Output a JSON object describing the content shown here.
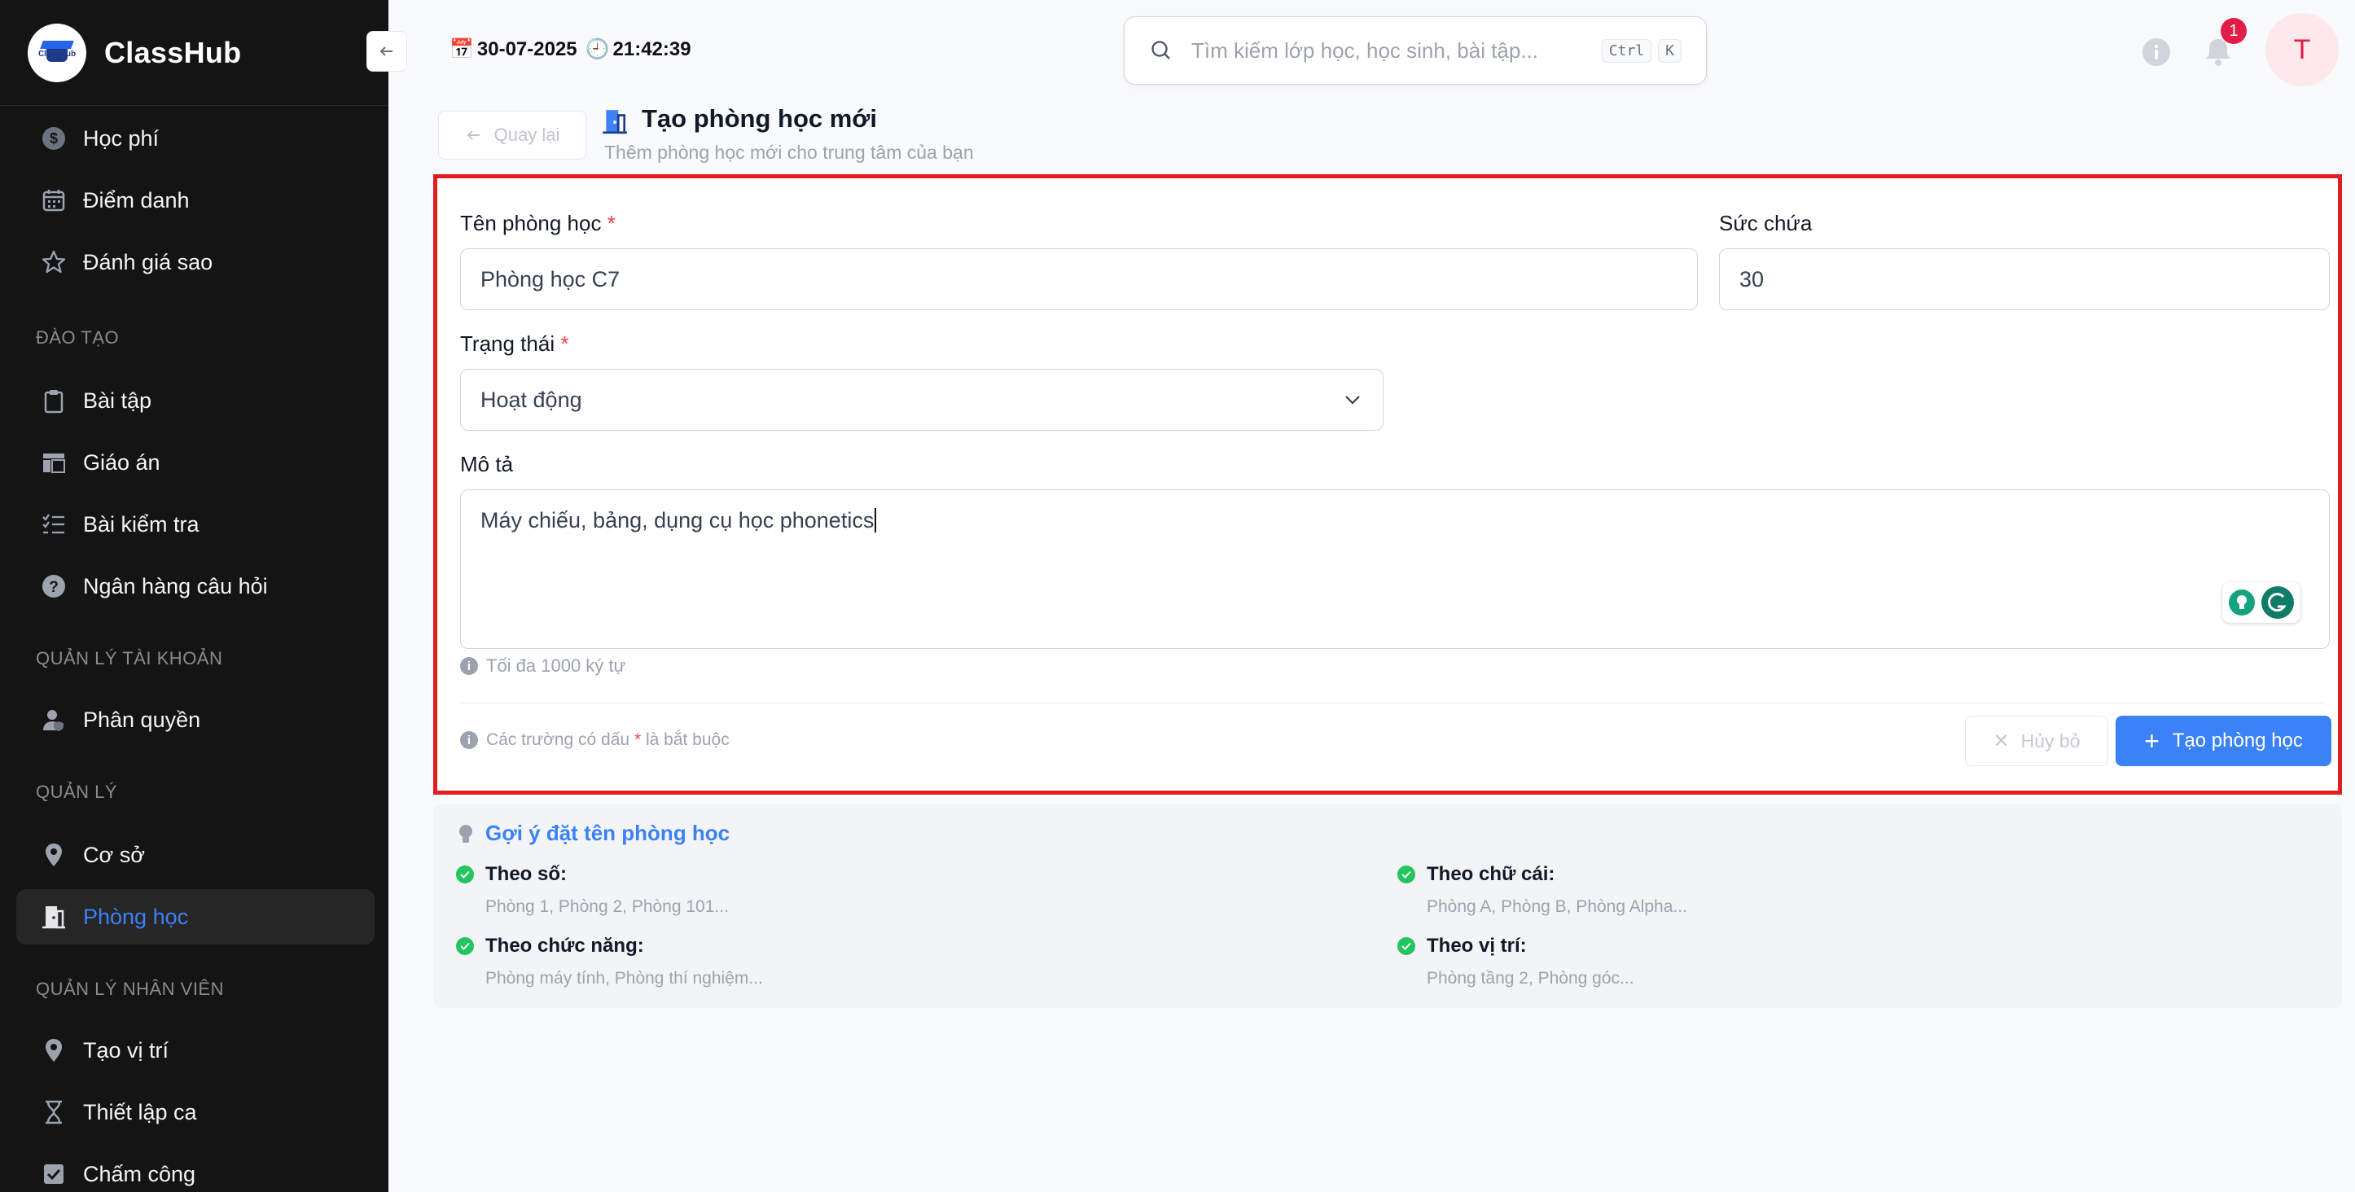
{
  "brand": {
    "name": "ClassHub",
    "logo_text": "ClassHub"
  },
  "sidebar": {
    "items_top": [
      {
        "label": "Học phí",
        "icon": "dollar-icon"
      },
      {
        "label": "Điểm danh",
        "icon": "calendar-icon"
      },
      {
        "label": "Đánh giá sao",
        "icon": "star-icon"
      }
    ],
    "sections": {
      "training": "ĐÀO TẠO",
      "account": "QUẢN LÝ TÀI KHOẢN",
      "manage": "QUẢN LÝ",
      "staff": "QUẢN LÝ NHÂN VIÊN"
    },
    "training_items": [
      {
        "label": "Bài tập",
        "icon": "clipboard-icon"
      },
      {
        "label": "Giáo án",
        "icon": "layout-icon"
      },
      {
        "label": "Bài kiểm tra",
        "icon": "checklist-icon"
      },
      {
        "label": "Ngân hàng câu hỏi",
        "icon": "question-icon"
      }
    ],
    "account_items": [
      {
        "label": "Phân quyền",
        "icon": "user-shield-icon"
      }
    ],
    "manage_items": [
      {
        "label": "Cơ sở",
        "icon": "location-icon"
      },
      {
        "label": "Phòng học",
        "icon": "door-icon",
        "active": true
      }
    ],
    "staff_items": [
      {
        "label": "Tạo vị trí",
        "icon": "location-icon"
      },
      {
        "label": "Thiết lập ca",
        "icon": "hourglass-icon"
      },
      {
        "label": "Chấm công",
        "icon": "check-square-icon"
      }
    ]
  },
  "header": {
    "date": "30-07-2025",
    "time": "21:42:39",
    "search_placeholder": "Tìm kiếm lớp học, học sinh, bài tập...",
    "kbd_ctrl": "Ctrl",
    "kbd_k": "K",
    "notifications_count": "1",
    "avatar_initial": "T"
  },
  "page": {
    "back_label": "Quay lại",
    "title": "Tạo phòng học mới",
    "subtitle": "Thêm phòng học mới cho trung tâm của bạn"
  },
  "form": {
    "name_label": "Tên phòng học",
    "name_value": "Phòng học C7",
    "capacity_label": "Sức chứa",
    "capacity_value": "30",
    "status_label": "Trạng thái",
    "status_value": "Hoạt động",
    "desc_label": "Mô tả",
    "desc_value": "Máy chiếu, bảng, dụng cụ học phonetics",
    "desc_hint": "Tối đa 1000 ký tự",
    "required_star": "*",
    "required_note_prefix": "Các trường có dấu",
    "required_note_suffix": "là bắt buộc",
    "cancel_label": "Hủy bỏ",
    "submit_label": "Tạo phòng học"
  },
  "suggestions": {
    "title": "Gợi ý đặt tên phòng học",
    "items": [
      {
        "head": "Theo số:",
        "desc": "Phòng 1, Phòng 2, Phòng 101..."
      },
      {
        "head": "Theo chữ cái:",
        "desc": "Phòng A, Phòng B, Phòng Alpha..."
      },
      {
        "head": "Theo chức năng:",
        "desc": "Phòng máy tính, Phòng thí nghiệm..."
      },
      {
        "head": "Theo vị trí:",
        "desc": "Phòng tầng 2, Phòng góc..."
      }
    ]
  },
  "colors": {
    "accent": "#3b82f6",
    "required": "#ef4444",
    "sidebar_bg": "#141414",
    "highlight_border": "#e11d1d"
  }
}
